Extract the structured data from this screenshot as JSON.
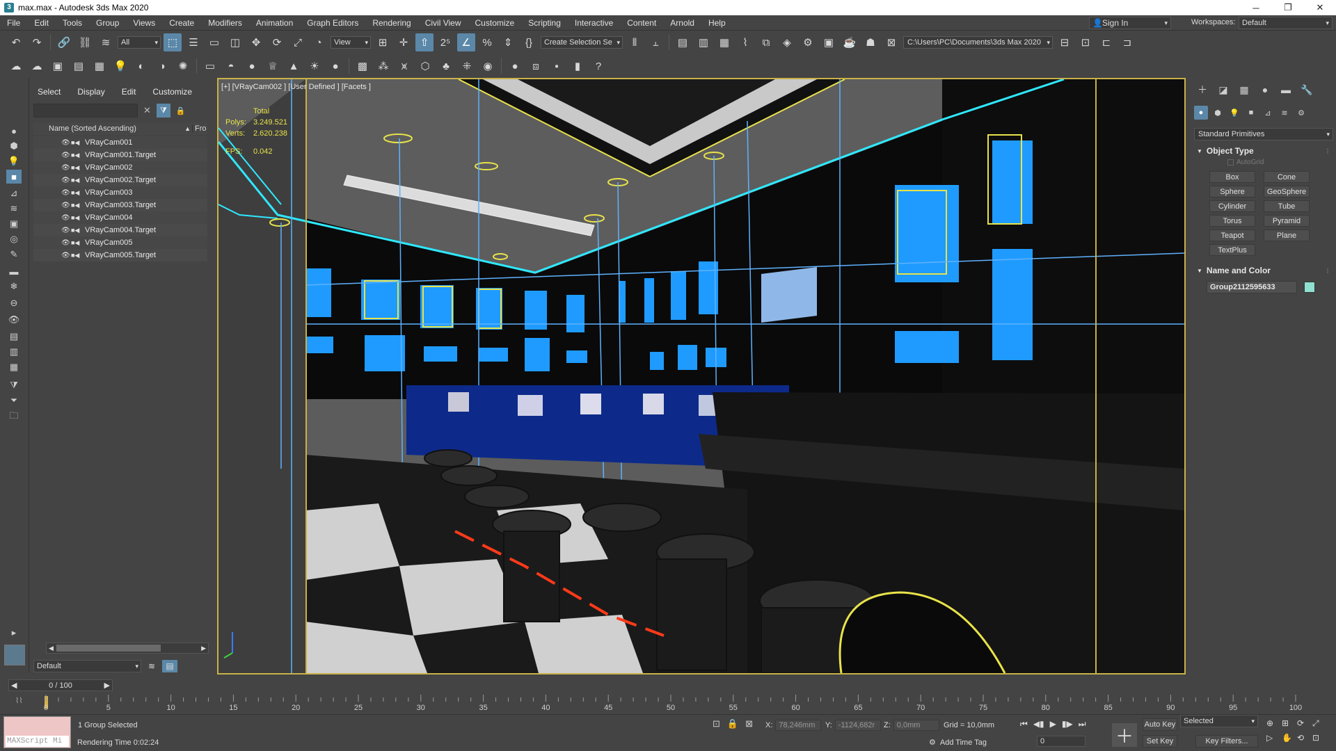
{
  "window": {
    "title": "max.max - Autodesk 3ds Max 2020",
    "app_icon_glyph": "3"
  },
  "menu": {
    "items": [
      "File",
      "Edit",
      "Tools",
      "Group",
      "Views",
      "Create",
      "Modifiers",
      "Animation",
      "Graph Editors",
      "Rendering",
      "Civil View",
      "Customize",
      "Scripting",
      "Interactive",
      "Content",
      "Arnold",
      "Help"
    ],
    "sign_in": "Sign In",
    "workspaces_label": "Workspaces:",
    "workspace_value": "Default"
  },
  "toolbar": {
    "selection_filter": "All",
    "reference_coord": "View",
    "selection_set": "Create Selection Se",
    "project_path": "C:\\Users\\PC\\Documents\\3ds Max 2020"
  },
  "explorer": {
    "tabs": [
      "Select",
      "Display",
      "Edit",
      "Customize"
    ],
    "search_value": "",
    "col_name": "Name (Sorted Ascending)",
    "col_frozen": "Fro",
    "items": [
      "VRayCam001",
      "VRayCam001.Target",
      "VRayCam002",
      "VRayCam002.Target",
      "VRayCam003",
      "VRayCam003.Target",
      "VRayCam004",
      "VRayCam004.Target",
      "VRayCam005",
      "VRayCam005.Target"
    ],
    "layer": "Default"
  },
  "viewport": {
    "label": "[+] [VRayCam002 ] [User Defined ] [Facets ]",
    "stats": {
      "total": "Total",
      "polys_label": "Polys:",
      "polys": "3.249.521",
      "verts_label": "Verts:",
      "verts": "2.620.238",
      "fps_label": "FPS:",
      "fps": "0.042"
    }
  },
  "command_panel": {
    "primitive_type": "Standard Primitives",
    "object_type_title": "Object Type",
    "autogrid": "AutoGrid",
    "objects": [
      "Box",
      "Cone",
      "Sphere",
      "GeoSphere",
      "Cylinder",
      "Tube",
      "Torus",
      "Pyramid",
      "Teapot",
      "Plane",
      "TextPlus"
    ],
    "name_color_title": "Name and Color",
    "object_name": "Group2112595633",
    "object_color": "#8fe0d0"
  },
  "timeline": {
    "current": "0 / 100",
    "ticks": [
      0,
      5,
      10,
      15,
      20,
      25,
      30,
      35,
      40,
      45,
      50,
      55,
      60,
      65,
      70,
      75,
      80,
      85,
      90,
      95,
      100
    ]
  },
  "status": {
    "maxscript": "MAXScript Mi",
    "selection": "1 Group Selected",
    "render_time": "Rendering Time  0:02:24",
    "x_label": "X:",
    "x_value": "78,246mm",
    "y_label": "Y:",
    "y_value": "-1124,682r",
    "z_label": "Z:",
    "z_value": "0,0mm",
    "grid": "Grid = 10,0mm",
    "add_time_tag": "Add Time Tag",
    "frame": "0",
    "auto_key": "Auto Key",
    "set_key": "Set Key",
    "selected": "Selected",
    "key_filters": "Key Filters..."
  },
  "colors": {
    "accent": "#5b88a8",
    "viewport_border": "#c9b24a",
    "stats_text": "#e8e34a",
    "cyan_line": "#2fe8ff",
    "light_blue": "#1f9bff"
  }
}
